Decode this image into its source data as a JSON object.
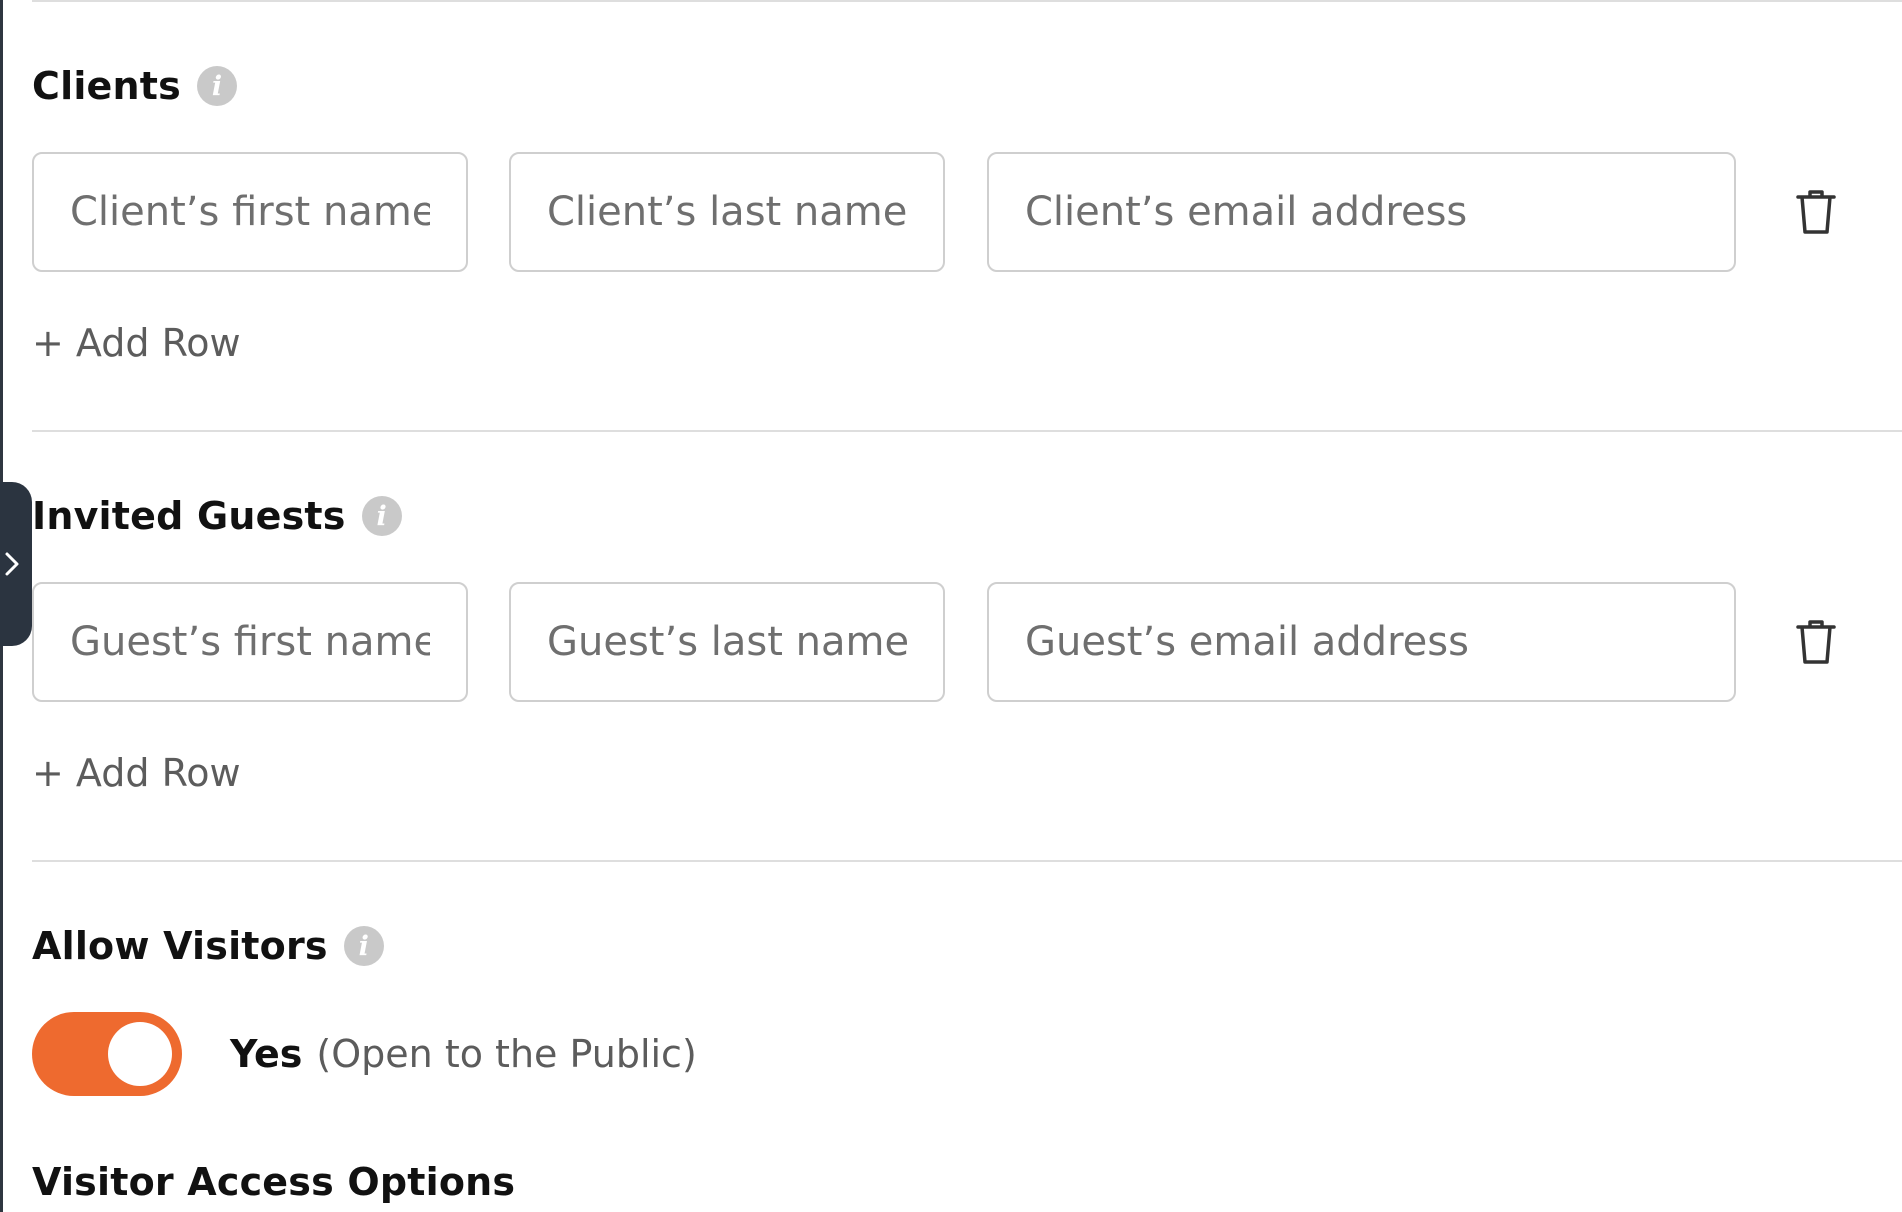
{
  "clients": {
    "title": "Clients",
    "info_icon": "info-icon",
    "first_name_placeholder": "Client’s first name",
    "last_name_placeholder": "Client’s last name",
    "email_placeholder": "Client’s email address",
    "delete_icon": "trash-icon",
    "add_row_label": "+ Add Row"
  },
  "guests": {
    "title": "Invited Guests",
    "info_icon": "info-icon",
    "first_name_placeholder": "Guest’s first name",
    "last_name_placeholder": "Guest’s last name",
    "email_placeholder": "Guest’s email address",
    "delete_icon": "trash-icon",
    "add_row_label": "+ Add Row"
  },
  "visitors": {
    "title": "Allow Visitors",
    "info_icon": "info-icon",
    "toggle_on": true,
    "toggle_value_label": "Yes",
    "toggle_description": "(Open to the Public)"
  },
  "visitor_access": {
    "title": "Visitor Access Options"
  },
  "sidebar_toggle": {
    "icon": "chevron-right-icon"
  },
  "colors": {
    "accent": "#ee6a2f",
    "sidebar_tab": "#2b3440",
    "border": "#cfcfcf",
    "info_icon": "#c9c9c9"
  }
}
